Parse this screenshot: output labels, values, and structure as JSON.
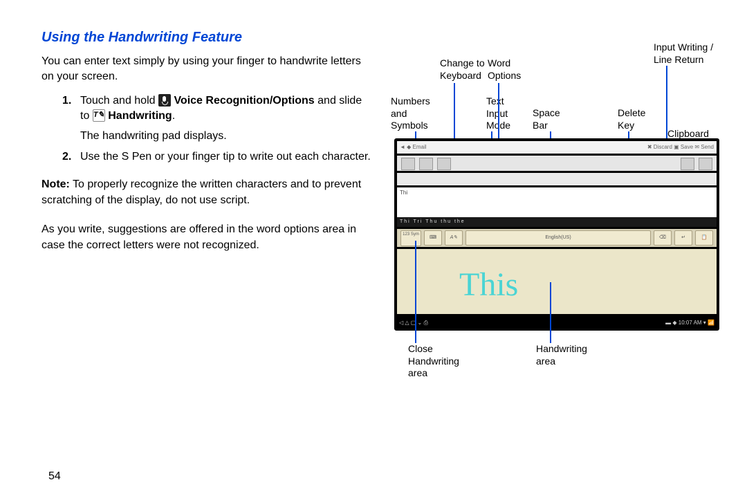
{
  "heading": "Using the Handwriting Feature",
  "intro": "You can enter text simply by using your finger to handwrite letters on your screen.",
  "step1_num": "1.",
  "step1_a": "Touch and hold ",
  "step1_b": "Voice Recognition/Options",
  "step1_c": " and slide to ",
  "step1_d": "Handwriting",
  "step1_e": ".",
  "step1_sub": "The handwriting pad displays.",
  "step2_num": "2.",
  "step2": "Use the S Pen or your finger tip to write out each character.",
  "note_label": "Note:",
  "note_text": " To properly recognize the written characters and to prevent scratching of the display, do not use script.",
  "para2": "As you write, suggestions are offered in the word options area in case the correct letters were not recognized.",
  "pagenum": "54",
  "labels": {
    "numbers": "Numbers and Symbols",
    "change_kbd": "Change to Keyboard",
    "word_opts": "Word Options",
    "text_input": "Text Input Mode",
    "space": "Space Bar",
    "delete": "Delete Key",
    "input_writing": "Input Writing / Line Return",
    "clipboard": "Clipboard",
    "close_hw": "Close Handwriting area",
    "hw_area": "Handwriting area"
  },
  "device": {
    "email_left": "◄  ◆  Email",
    "email_right": "✖ Discard   ▣ Save   ✉ Send",
    "body_typed": "Thi",
    "suggestions": "Thi  Tri  Thu  thu  the",
    "sym_btn": "123 Sym",
    "space_label": "English(US)",
    "handwritten": "This",
    "nav_left": "◁   △   ▢   ⌄   ⎙",
    "nav_right": "▬  ◆  10:07 AM  ▾ 📶"
  }
}
